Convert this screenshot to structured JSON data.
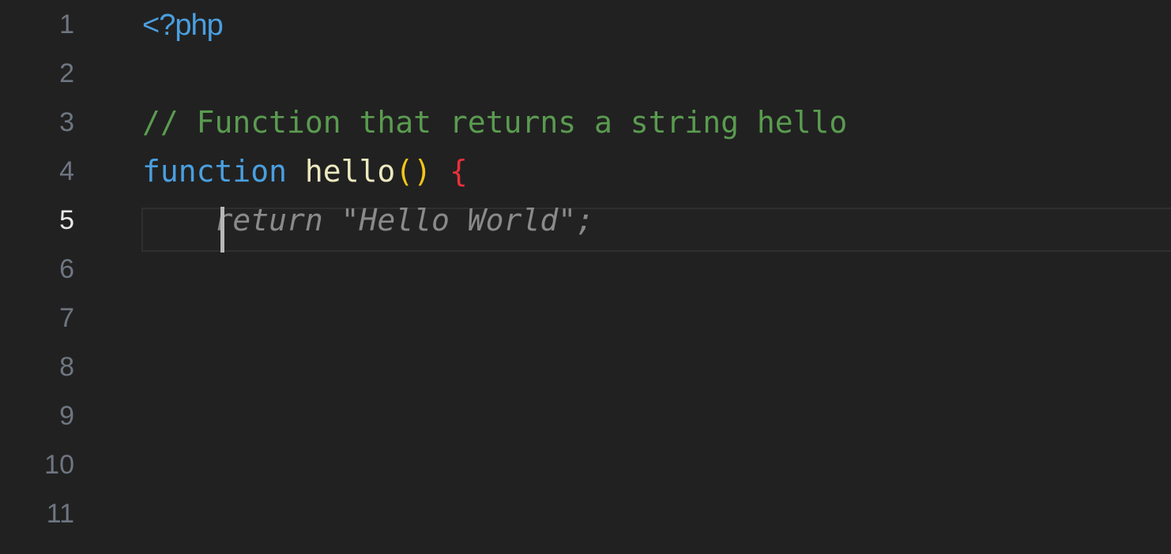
{
  "editor": {
    "language": "php",
    "background_color": "#212121",
    "gutter": {
      "line_numbers": [
        "1",
        "2",
        "3",
        "4",
        "5",
        "6",
        "7",
        "8",
        "9",
        "10",
        "11"
      ],
      "active_line_number": "5",
      "number_color": "#6e7681",
      "active_number_color": "#e8e8e8"
    },
    "colors": {
      "php_tag": "#4a9fe0",
      "comment": "#5a9b50",
      "keyword": "#4a9fe0",
      "function_name": "#ece9c0",
      "parenthesis": "#f5c518",
      "brace": "#e8303c",
      "ghost_text": "#8a8a8a",
      "caret": "#b7b7b7",
      "active_line_border": "#2f2f2f"
    },
    "lines": [
      {
        "n": "1",
        "php_tag": "<?php"
      },
      {
        "n": "2",
        "empty": ""
      },
      {
        "n": "3",
        "comment": "// Function that returns a string hello"
      },
      {
        "n": "4",
        "keyword": "function",
        "space1": " ",
        "func_name": "hello",
        "parens": "()",
        "space2": " ",
        "brace": "{"
      },
      {
        "n": "5",
        "indent": "    ",
        "ghost_text": "return \"Hello World\";"
      },
      {
        "n": "6",
        "empty": ""
      },
      {
        "n": "7",
        "empty": ""
      },
      {
        "n": "8",
        "empty": ""
      },
      {
        "n": "9",
        "empty": ""
      },
      {
        "n": "10",
        "empty": ""
      },
      {
        "n": "11",
        "empty": ""
      }
    ]
  }
}
